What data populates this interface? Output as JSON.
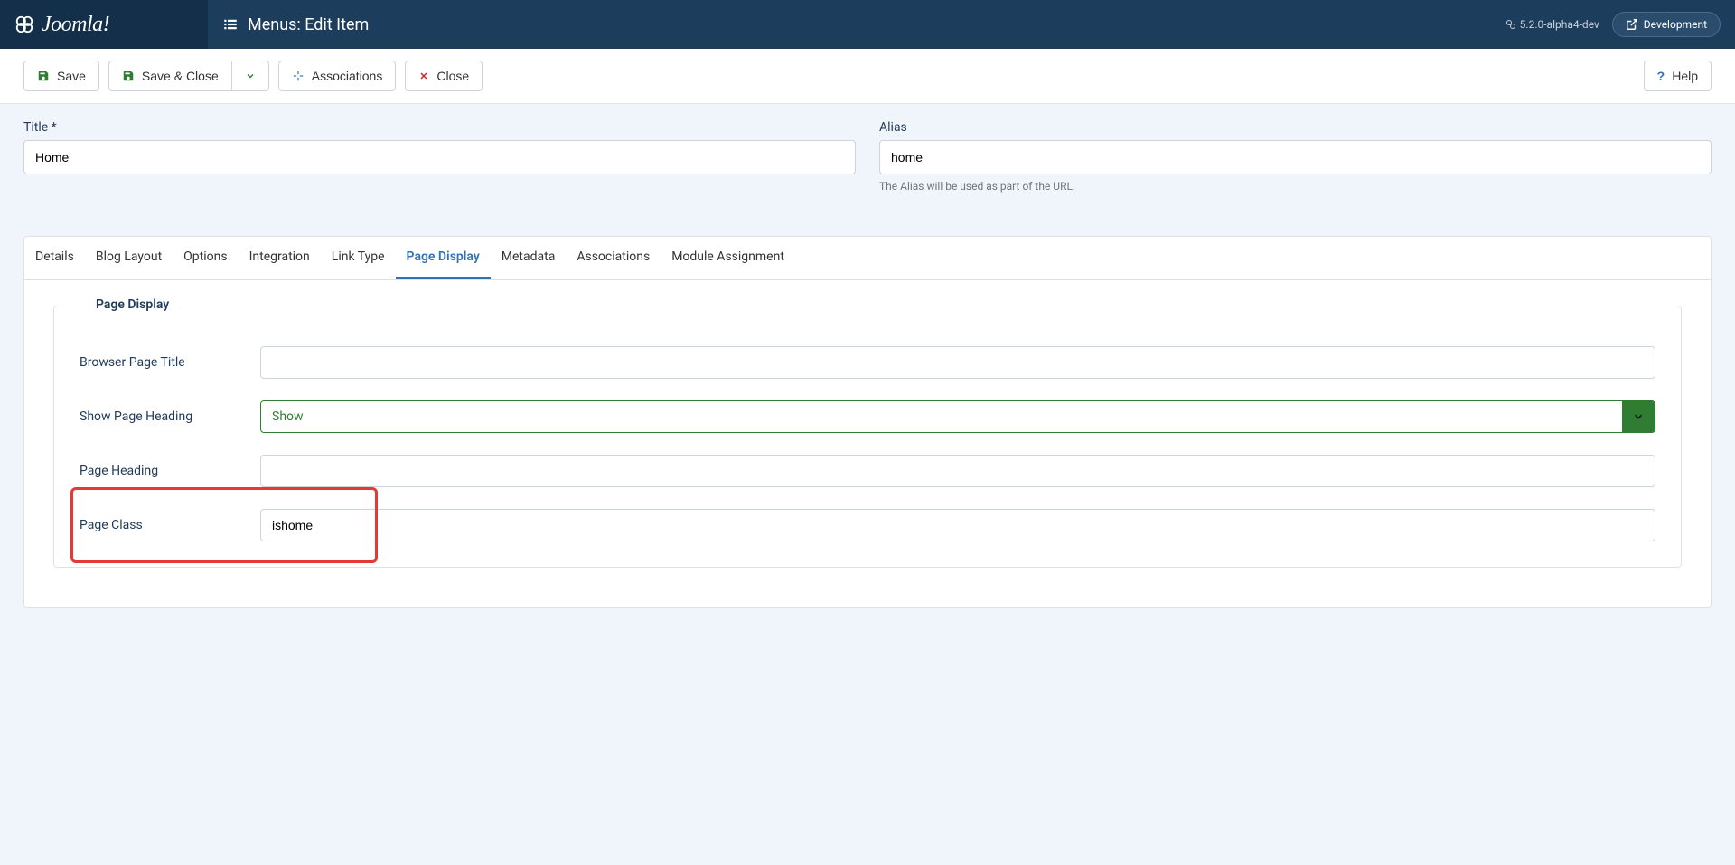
{
  "brand": "Joomla!",
  "header": {
    "page_title": "Menus: Edit Item"
  },
  "top_right": {
    "version": "5.2.0-alpha4-dev",
    "dev_label": "Development"
  },
  "toolbar": {
    "save": "Save",
    "save_close": "Save & Close",
    "associations": "Associations",
    "close": "Close",
    "help": "Help"
  },
  "fields": {
    "title_label": "Title *",
    "title_value": "Home",
    "alias_label": "Alias",
    "alias_value": "home",
    "alias_hint": "The Alias will be used as part of the URL."
  },
  "tabs": [
    "Details",
    "Blog Layout",
    "Options",
    "Integration",
    "Link Type",
    "Page Display",
    "Metadata",
    "Associations",
    "Module Assignment"
  ],
  "active_tab_index": 5,
  "page_display": {
    "legend": "Page Display",
    "browser_page_title_label": "Browser Page Title",
    "browser_page_title_value": "",
    "show_page_heading_label": "Show Page Heading",
    "show_page_heading_value": "Show",
    "page_heading_label": "Page Heading",
    "page_heading_value": "",
    "page_class_label": "Page Class",
    "page_class_value": "ishome"
  }
}
